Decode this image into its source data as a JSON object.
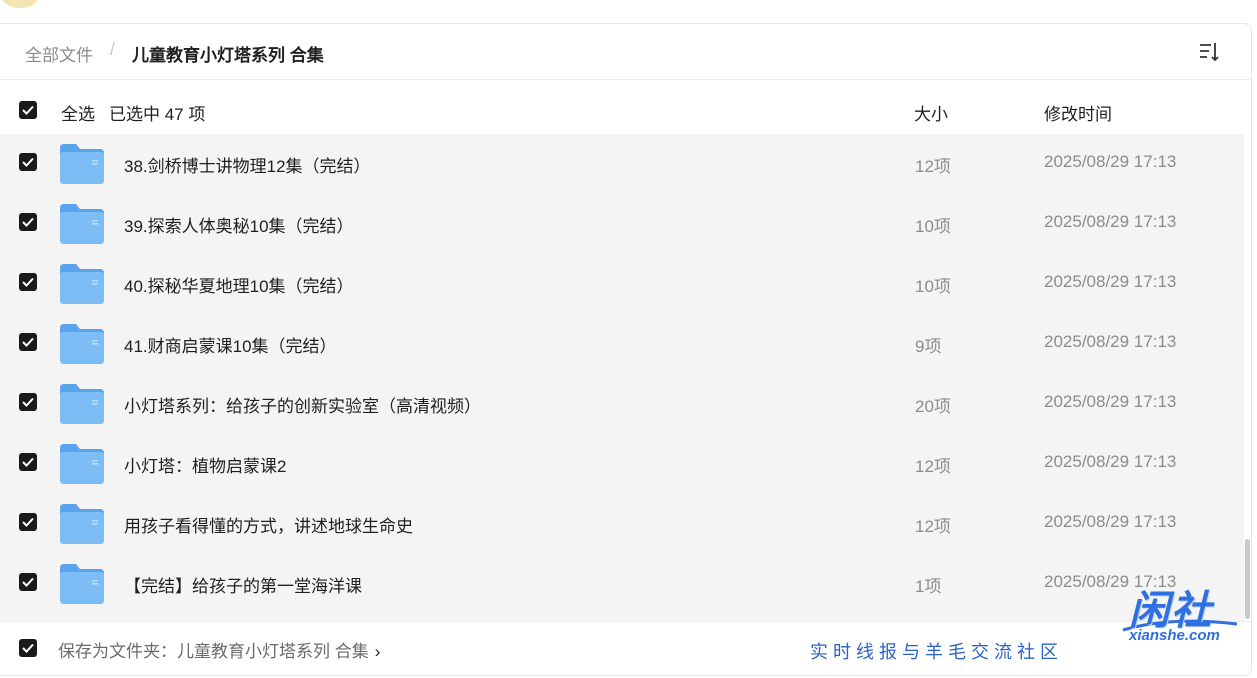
{
  "breadcrumb": {
    "root": "全部文件",
    "separator": "/",
    "current": "儿童教育小灯塔系列 合集"
  },
  "header": {
    "select_all": "全选",
    "selected_text": "已选中  47  项",
    "col_size": "大小",
    "col_time": "修改时间"
  },
  "files": [
    {
      "name": "38.剑桥博士讲物理12集（完结）",
      "size": "12项",
      "time": "2025/08/29 17:13"
    },
    {
      "name": "39.探索人体奥秘10集（完结）",
      "size": "10项",
      "time": "2025/08/29 17:13"
    },
    {
      "name": "40.探秘华夏地理10集（完结）",
      "size": "10项",
      "time": "2025/08/29 17:13"
    },
    {
      "name": "41.财商启蒙课10集（完结）",
      "size": "9项",
      "time": "2025/08/29 17:13"
    },
    {
      "name": "小灯塔系列：给孩子的创新实验室（高清视频）",
      "size": "20项",
      "time": "2025/08/29 17:13"
    },
    {
      "name": "小灯塔：植物启蒙课2",
      "size": "12项",
      "time": "2025/08/29 17:13"
    },
    {
      "name": "用孩子看得懂的方式，讲述地球生命史",
      "size": "12项",
      "time": "2025/08/29 17:13"
    },
    {
      "name": "【完结】给孩子的第一堂海洋课",
      "size": "1项",
      "time": "2025/08/29 17:13"
    }
  ],
  "footer": {
    "save_prefix": "保存为文件夹：",
    "save_folder": "儿童教育小灯塔系列 合集",
    "chevron": "›",
    "watermark_text": "实时线报与羊毛交流社区"
  },
  "logo": {
    "main": "闲社",
    "sub": "xianshe.com"
  },
  "colors": {
    "checkbox": "#1a1a1a",
    "folder": "#6fb3f2",
    "list_bg": "#f4f4f5",
    "brand_blue": "#2f6fe0"
  },
  "icons": {
    "checkbox": "checkbox-checked-icon",
    "folder": "folder-icon",
    "sort": "sort-list-icon"
  }
}
